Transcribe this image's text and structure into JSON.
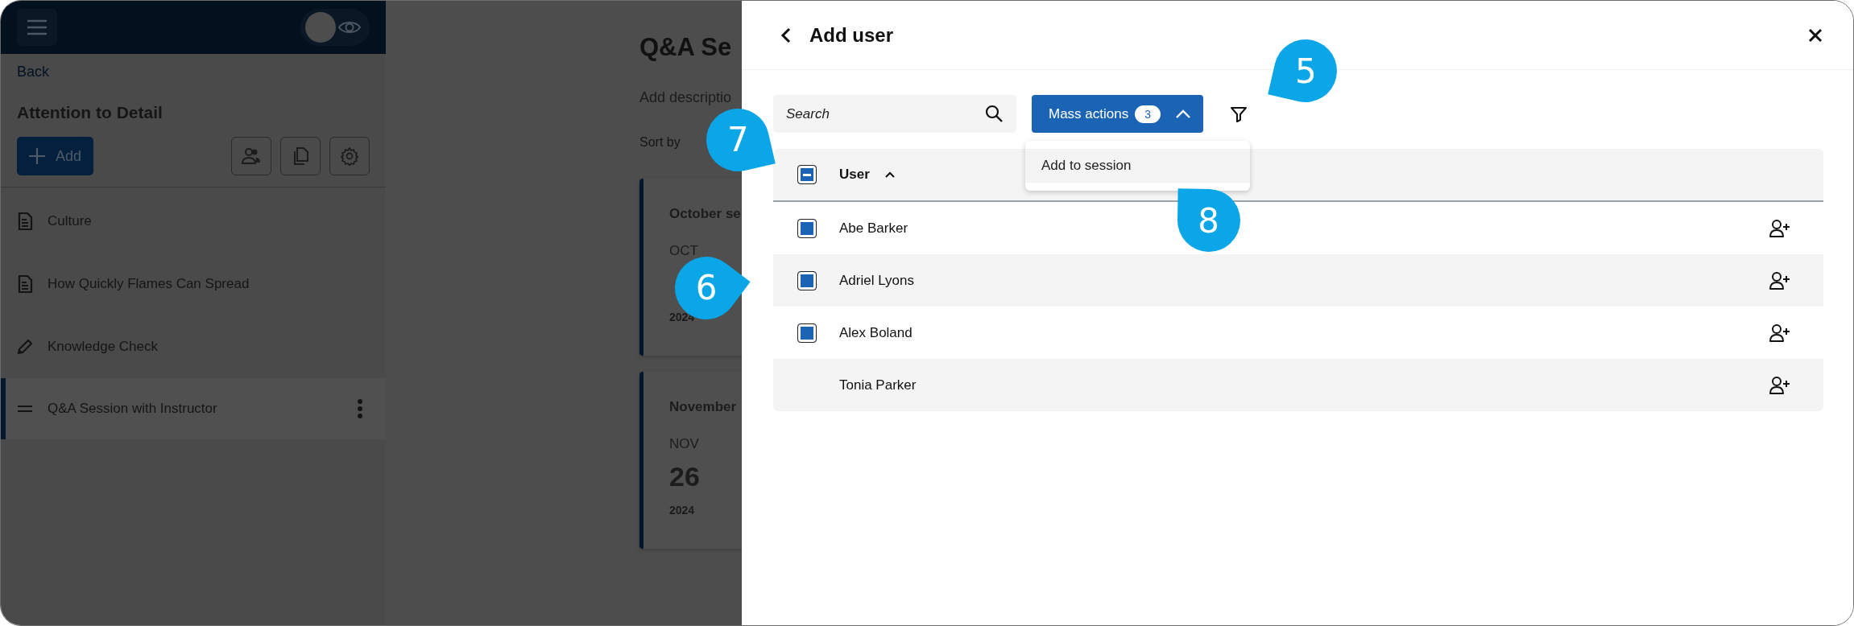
{
  "sidebar": {
    "preview_toggle": {
      "on": false
    },
    "back_link": "Back",
    "title": "Attention to Detail",
    "add_button": "Add",
    "items": [
      {
        "label": "Culture",
        "kind": "document",
        "selected": false
      },
      {
        "label": "How Quickly Flames Can Spread",
        "kind": "document",
        "selected": false
      },
      {
        "label": "Knowledge Check",
        "kind": "quiz",
        "selected": false
      },
      {
        "label": "Q&A Session with Instructor",
        "kind": "session",
        "selected": true
      }
    ]
  },
  "main": {
    "title": "Q&A Se",
    "description_placeholder": "Add descriptio",
    "sort_label": "Sort by",
    "sessions": [
      {
        "title": "October se",
        "month": "OCT",
        "year": "2024"
      },
      {
        "title": "November",
        "month": "NOV",
        "day": "26",
        "year": "2024"
      }
    ]
  },
  "drawer": {
    "title": "Add user",
    "search": {
      "placeholder": "Search"
    },
    "mass_actions": {
      "label": "Mass actions",
      "count": "3",
      "expanded": true
    },
    "menu": [
      "Add to session"
    ],
    "table": {
      "partially_checked": true,
      "columns": [
        {
          "label": "User",
          "sort_ascending": true
        }
      ],
      "rows": [
        {
          "name": "Abe Barker",
          "checked": true
        },
        {
          "name": "Adriel Lyons",
          "checked": true
        },
        {
          "name": "Alex Boland",
          "checked": true
        },
        {
          "name": "Tonia Parker",
          "checked": false
        }
      ]
    }
  },
  "callouts": [
    {
      "number": "5"
    },
    {
      "number": "6"
    },
    {
      "number": "7"
    },
    {
      "number": "8"
    }
  ]
}
